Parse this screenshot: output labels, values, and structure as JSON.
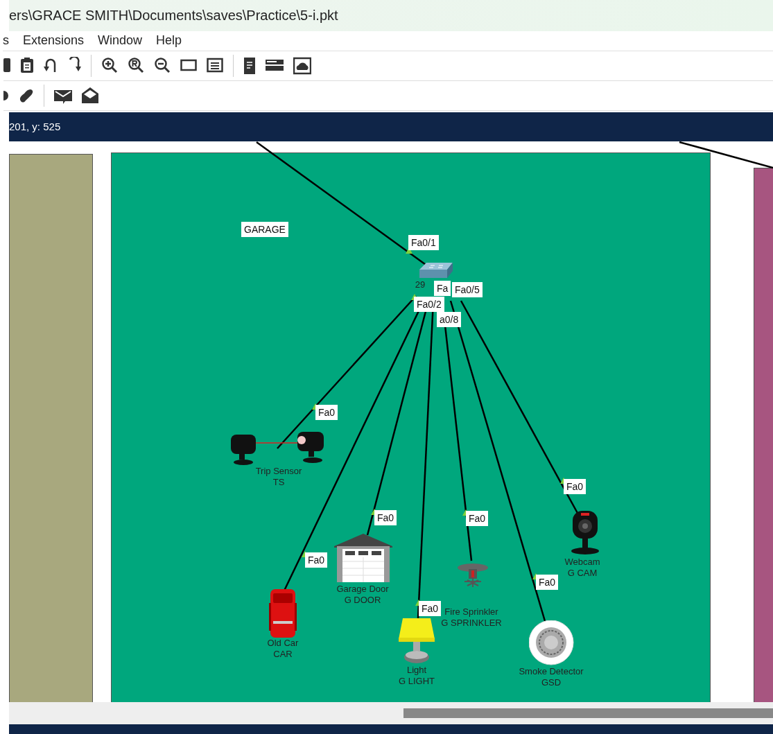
{
  "window": {
    "title": "ers\\GRACE SMITH\\Documents\\saves\\Practice\\5-i.pkt"
  },
  "menu": [
    {
      "label": "s"
    },
    {
      "label": "Extensions"
    },
    {
      "label": "Window"
    },
    {
      "label": "Help"
    }
  ],
  "coordinates": "201, y: 525",
  "canvas": {
    "areas": [
      {
        "color": "#a8a87e"
      },
      {
        "color": "#00a77d",
        "label": "GARAGE"
      },
      {
        "color": "#a75580"
      }
    ],
    "switch": {
      "label": "29",
      "ports": [
        {
          "label": "Fa0/1"
        },
        {
          "label": "Fa"
        },
        {
          "label": "Fa0/5"
        },
        {
          "label": "Fa0/2"
        },
        {
          "label": "a0/8"
        }
      ]
    },
    "devices": [
      {
        "kind": "trip-sensor",
        "name": "Trip Sensor",
        "hostname": "TS",
        "port": "Fa0"
      },
      {
        "kind": "webcam",
        "name": "Webcam",
        "hostname": "G CAM",
        "port": "Fa0"
      },
      {
        "kind": "garage-door",
        "name": "Garage Door",
        "hostname": "G DOOR",
        "port": "Fa0"
      },
      {
        "kind": "sprinkler",
        "name": "Fire Sprinkler",
        "hostname": "G SPRINKLER",
        "port": "Fa0"
      },
      {
        "kind": "car",
        "name": "Old Car",
        "hostname": "CAR",
        "port": "Fa0"
      },
      {
        "kind": "light",
        "name": "Light",
        "hostname": "G LIGHT",
        "port": "Fa0"
      },
      {
        "kind": "smoke-detector",
        "name": "Smoke Detector",
        "hostname": "GSD",
        "port": "Fa0"
      }
    ]
  }
}
